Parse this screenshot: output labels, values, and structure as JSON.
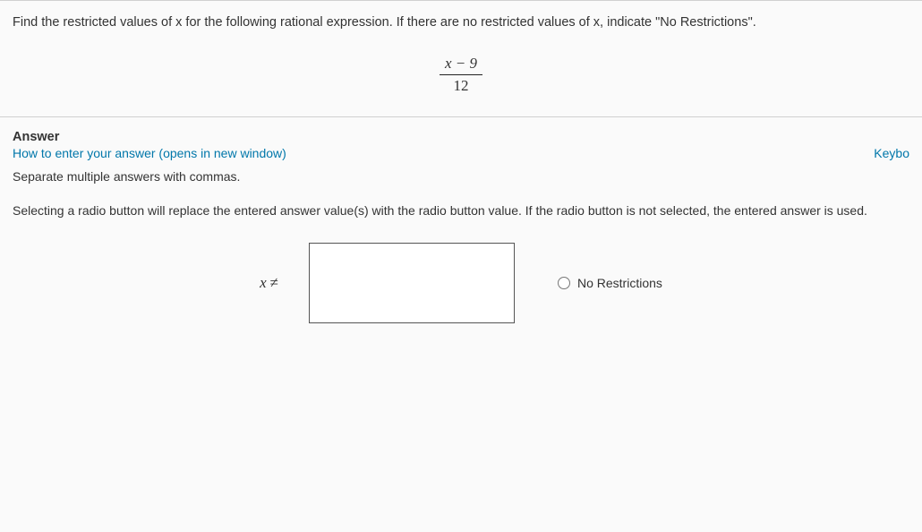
{
  "question": {
    "prompt": "Find the restricted values of x for the following rational expression. If there are no restricted values of x, indicate \"No Restrictions\".",
    "expression": {
      "numerator": "x − 9",
      "denominator": "12"
    }
  },
  "answer": {
    "heading": "Answer",
    "help_link": "How to enter your answer (opens in new window)",
    "keyboard_hint": "Keybo",
    "separate_note": "Separate multiple answers with commas.",
    "radio_note": "Selecting a radio button will replace the entered answer value(s) with the radio button value. If the radio button is not selected, the entered answer is used.",
    "x_label": "x",
    "neq_symbol": "≠",
    "input_value": "",
    "no_restrictions_label": "No Restrictions"
  }
}
